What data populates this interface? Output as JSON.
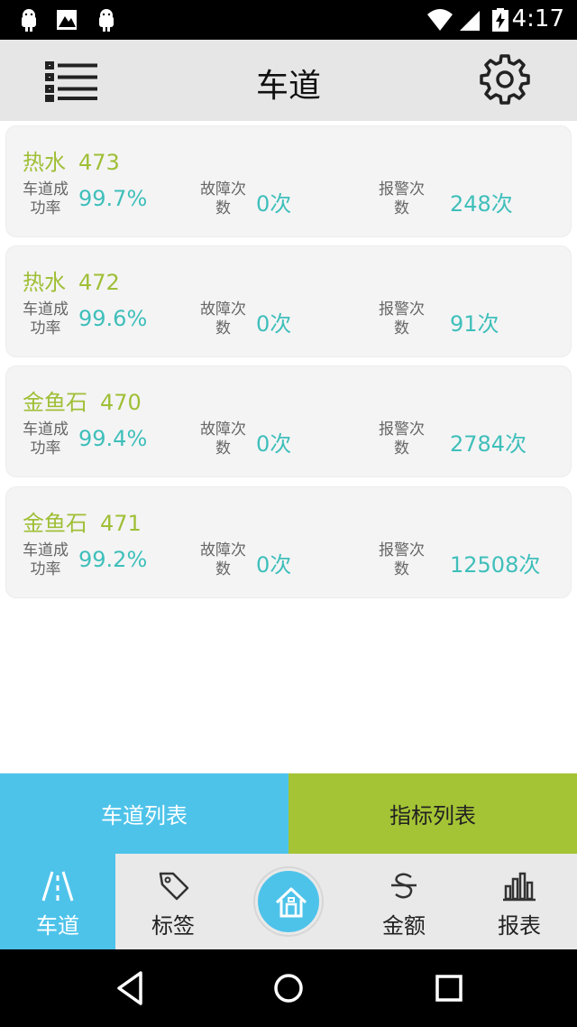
{
  "status_bar": {
    "time": "4:17",
    "left_icons": [
      "android-icon",
      "image-notification-icon",
      "android-icon"
    ],
    "right_icons": [
      "wifi-icon",
      "signal-icon",
      "battery-charging-icon"
    ]
  },
  "header": {
    "title": "车道",
    "menu_icon": "list-icon",
    "settings_icon": "gear-icon"
  },
  "lanes": [
    {
      "name": "热水",
      "number": "473",
      "success_label_1": "车道成",
      "success_label_2": "功率",
      "success_value": "99.7%",
      "fault_label_1": "故障次",
      "fault_label_2": "数",
      "fault_value": "0次",
      "alarm_label_1": "报警次",
      "alarm_label_2": "数",
      "alarm_value": "248次"
    },
    {
      "name": "热水",
      "number": "472",
      "success_label_1": "车道成",
      "success_label_2": "功率",
      "success_value": "99.6%",
      "fault_label_1": "故障次",
      "fault_label_2": "数",
      "fault_value": "0次",
      "alarm_label_1": "报警次",
      "alarm_label_2": "数",
      "alarm_value": "91次"
    },
    {
      "name": "金鱼石",
      "number": "470",
      "success_label_1": "车道成",
      "success_label_2": "功率",
      "success_value": "99.4%",
      "fault_label_1": "故障次",
      "fault_label_2": "数",
      "fault_value": "0次",
      "alarm_label_1": "报警次",
      "alarm_label_2": "数",
      "alarm_value": "2784次"
    },
    {
      "name": "金鱼石",
      "number": "471",
      "success_label_1": "车道成",
      "success_label_2": "功率",
      "success_value": "99.2%",
      "fault_label_1": "故障次",
      "fault_label_2": "数",
      "fault_value": "0次",
      "alarm_label_1": "报警次",
      "alarm_label_2": "数",
      "alarm_value": "12508次"
    }
  ],
  "tabs": {
    "lane_list": "车道列表",
    "index_list": "指标列表"
  },
  "bottom_nav": {
    "lane": "车道",
    "tag": "标签",
    "home_icon": "home-icon",
    "amount": "金额",
    "report": "报表"
  },
  "colors": {
    "accent_blue": "#4ec3ea",
    "accent_green": "#a5c435",
    "lane_name": "#9fbf36",
    "value_teal": "#3fbfba"
  }
}
